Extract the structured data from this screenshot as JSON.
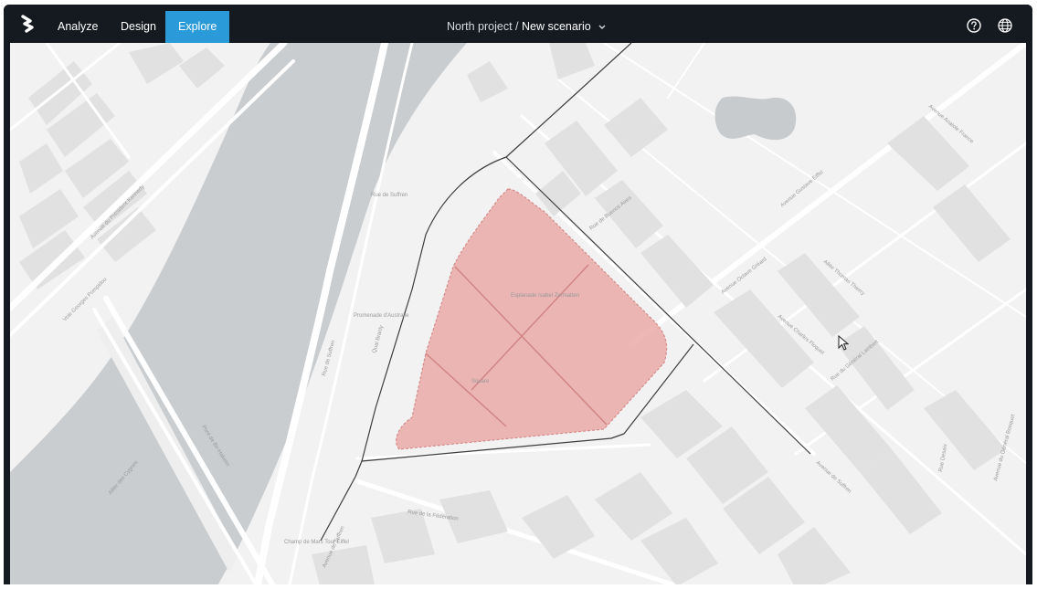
{
  "app": {
    "nav": [
      {
        "label": "Analyze",
        "active": false
      },
      {
        "label": "Design",
        "active": false
      },
      {
        "label": "Explore",
        "active": true
      }
    ],
    "breadcrumb": {
      "project": "North project",
      "separator": " / ",
      "scenario": "New scenario"
    },
    "icons": {
      "logo": "app-logo",
      "help": "help-icon",
      "language": "globe-icon",
      "dropdown": "chevron-down-icon",
      "cursor": "mouse-pointer-icon"
    },
    "colors": {
      "topbar": "#151a20",
      "active_tab": "#2a9bd8",
      "water": "#c9cdd0",
      "land": "#f2f2f2",
      "building": "#e1e1e1",
      "road": "#ffffff",
      "boundary": "#3c3c3c",
      "selected_area_fill": "#e8a7a5",
      "selected_area_stroke": "#d58b89"
    }
  },
  "map": {
    "labels": {
      "quai_branly": "Quai Branly",
      "promenade": "Promenade d'Australie",
      "rue_suffren_1": "Rue de Suffren",
      "rue_suffren_2": "Rue de Suffren",
      "esplanade": "Esplanade Isabel Zermatten",
      "square": "Square",
      "avenue_octave": "Avenue Octave Gréard",
      "avenue_charles": "Avenue Charles Floquet",
      "allee_thierry": "Allée Thomas Thierry",
      "rue_buenos": "Rue de Buenos Aires",
      "avenue_suffren": "Avenue de Suffren",
      "rue_federation": "Rue de la Fédération",
      "pont_bir_hakeim": "Pont de Bir-Hakeim",
      "allee_cygnes": "Allée des Cygnes",
      "avenue_pompidou": "Voie Georges Pompidou",
      "avenue_kennedy": "Avenue du Président Kennedy",
      "avenue_gustave": "Avenue Gustave Eiffel",
      "avenue_anatole": "Avenue Anatole France",
      "rue_general": "Rue du Général Lambert",
      "rue_desaix": "Rue Desaix",
      "champ_mars": "Champ de Mars Tour Eiffel",
      "avenue_suffren_b": "Avenue de Suffren",
      "avenue_bosquet": "Avenue du Général Bosquet"
    }
  }
}
